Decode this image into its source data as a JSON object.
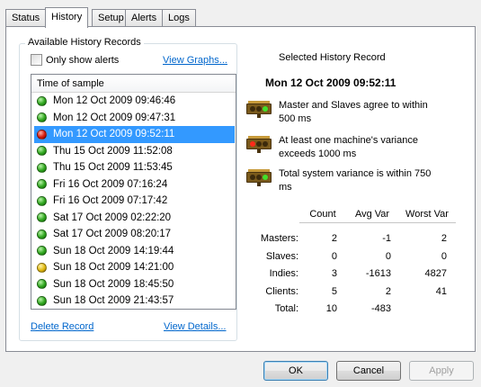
{
  "tabs": [
    {
      "label": "Status"
    },
    {
      "label": "History"
    },
    {
      "label": "Setup"
    },
    {
      "label": "Alerts"
    },
    {
      "label": "Logs"
    }
  ],
  "history_group": {
    "legend": "Available History Records",
    "only_alerts_label": "Only show alerts",
    "only_alerts_checked": false,
    "view_graphs": "View Graphs...",
    "column_header": "Time of sample",
    "records": [
      {
        "time": "Mon 12 Oct 2009 09:46:46",
        "status": "green",
        "selected": false
      },
      {
        "time": "Mon 12 Oct 2009 09:47:31",
        "status": "green",
        "selected": false
      },
      {
        "time": "Mon 12 Oct 2009 09:52:11",
        "status": "red",
        "selected": true
      },
      {
        "time": "Thu 15 Oct 2009 11:52:08",
        "status": "green",
        "selected": false
      },
      {
        "time": "Thu 15 Oct 2009 11:53:45",
        "status": "green",
        "selected": false
      },
      {
        "time": "Fri 16 Oct 2009 07:16:24",
        "status": "green",
        "selected": false
      },
      {
        "time": "Fri 16 Oct 2009 07:17:42",
        "status": "green",
        "selected": false
      },
      {
        "time": "Sat 17 Oct 2009 02:22:20",
        "status": "green",
        "selected": false
      },
      {
        "time": "Sat 17 Oct 2009 08:20:17",
        "status": "green",
        "selected": false
      },
      {
        "time": "Sun 18 Oct 2009 14:19:44",
        "status": "green",
        "selected": false
      },
      {
        "time": "Sun 18 Oct 2009 14:21:00",
        "status": "yellow",
        "selected": false
      },
      {
        "time": "Sun 18 Oct 2009 18:45:50",
        "status": "green",
        "selected": false
      },
      {
        "time": "Sun 18 Oct 2009 21:43:57",
        "status": "green",
        "selected": false
      }
    ],
    "delete_record": "Delete Record",
    "view_details": "View Details..."
  },
  "detail": {
    "title": "Selected History Record",
    "date": "Mon 12 Oct 2009 09:52:11",
    "statuses": [
      {
        "text": "Master and Slaves agree to within 500 ms",
        "light": "green"
      },
      {
        "text": "At least one machine's variance exceeds 1000 ms",
        "light": "red"
      },
      {
        "text": "Total system variance is within 750 ms",
        "light": "green"
      }
    ],
    "stats": {
      "headers": [
        "Count",
        "Avg Var",
        "Worst Var"
      ],
      "rows": [
        {
          "label": "Masters:",
          "count": "2",
          "avg": "-1",
          "worst": "2"
        },
        {
          "label": "Slaves:",
          "count": "0",
          "avg": "0",
          "worst": "0"
        },
        {
          "label": "Indies:",
          "count": "3",
          "avg": "-1613",
          "worst": "4827"
        },
        {
          "label": "Clients:",
          "count": "5",
          "avg": "2",
          "worst": "41"
        },
        {
          "label": "Total:",
          "count": "10",
          "avg": "-483",
          "worst": ""
        }
      ]
    }
  },
  "buttons": {
    "ok": "OK",
    "cancel": "Cancel",
    "apply": "Apply"
  }
}
